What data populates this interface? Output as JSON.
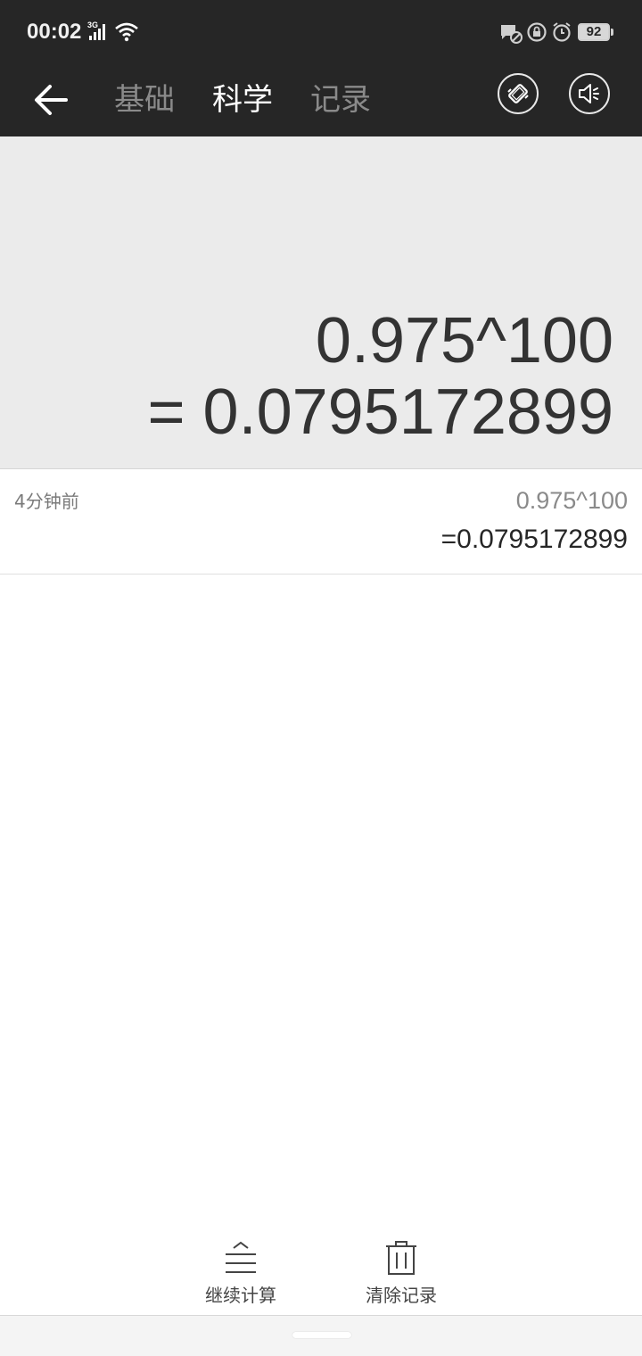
{
  "status_bar": {
    "time": "00:02",
    "network_type": "3G",
    "battery_level": "92",
    "icons": [
      "signal-icon",
      "wifi-icon",
      "message-blocked-icon",
      "rotation-lock-icon",
      "alarm-icon",
      "battery-icon"
    ]
  },
  "toolbar": {
    "back_icon": "arrow-left-icon",
    "tabs": [
      {
        "label": "基础",
        "active": false
      },
      {
        "label": "科学",
        "active": true
      },
      {
        "label": "记录",
        "active": false
      }
    ],
    "vibrate_icon": "vibrate-icon",
    "sound_icon": "speaker-icon"
  },
  "display": {
    "expression": "0.975^100",
    "result": "= 0.0795172899"
  },
  "history": [
    {
      "time": "4分钟前",
      "expression": "0.975^100",
      "result": "=0.0795172899"
    }
  ],
  "actions": {
    "continue_label": "继续计算",
    "continue_icon": "continue-lines-icon",
    "clear_label": "清除记录",
    "clear_icon": "trash-icon"
  },
  "colors": {
    "header_bg": "#262626",
    "display_bg": "#ebebeb",
    "active_tab": "#ffffff",
    "inactive_tab": "#8a8a8a"
  }
}
